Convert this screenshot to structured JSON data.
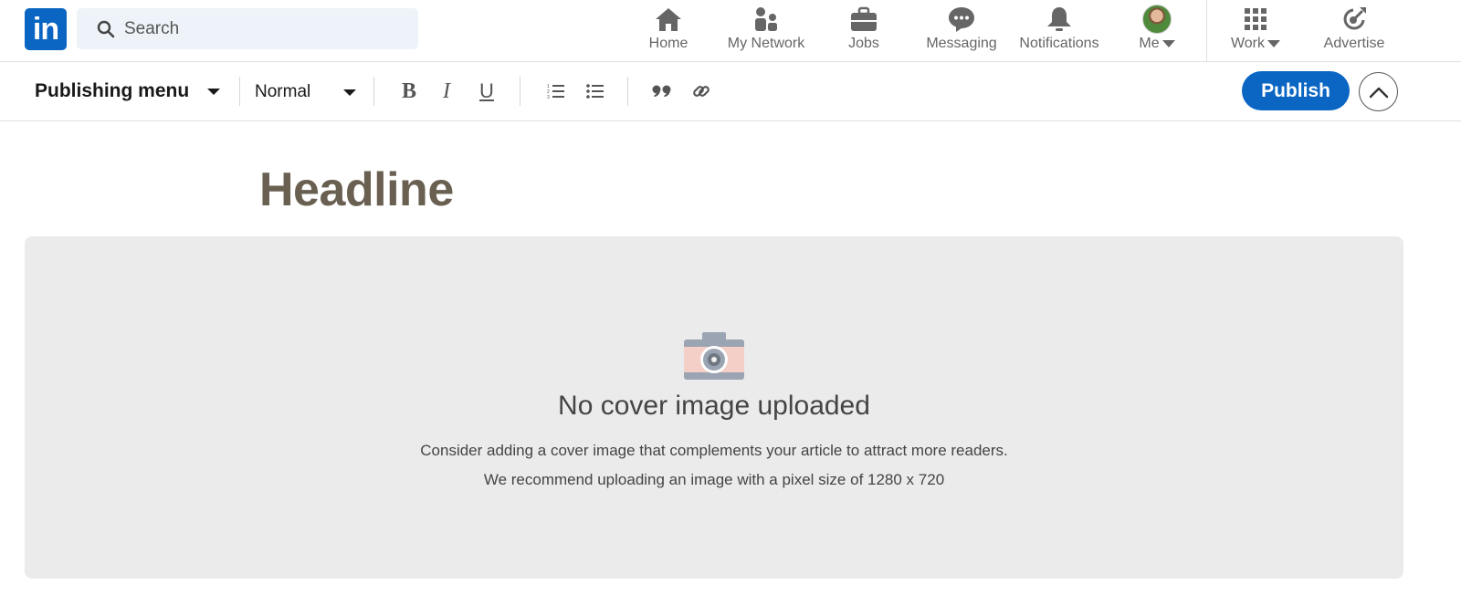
{
  "nav": {
    "logo_text": "in",
    "search_placeholder": "Search",
    "items": [
      {
        "label": "Home",
        "icon": "home-icon"
      },
      {
        "label": "My Network",
        "icon": "network-icon"
      },
      {
        "label": "Jobs",
        "icon": "briefcase-icon"
      },
      {
        "label": "Messaging",
        "icon": "messaging-icon"
      },
      {
        "label": "Notifications",
        "icon": "bell-icon"
      },
      {
        "label": "Me",
        "icon": "avatar"
      },
      {
        "label": "Work",
        "icon": "grid-icon"
      },
      {
        "label": "Advertise",
        "icon": "advertise-icon"
      }
    ]
  },
  "toolbar": {
    "publishing_menu": "Publishing menu",
    "text_style": "Normal",
    "bold": "B",
    "italic": "I",
    "underline": "U",
    "publish_label": "Publish"
  },
  "editor": {
    "headline_placeholder": "Headline",
    "cover": {
      "title": "No cover image uploaded",
      "line1": "Consider adding a cover image that complements your article to attract more readers.",
      "line2": "We recommend uploading an image with a pixel size of 1280 x 720"
    }
  },
  "colors": {
    "brand": "#0a66c2",
    "nav_icon": "#666666",
    "headline_placeholder": "#6a6052",
    "cover_bg": "#ebebeb"
  }
}
